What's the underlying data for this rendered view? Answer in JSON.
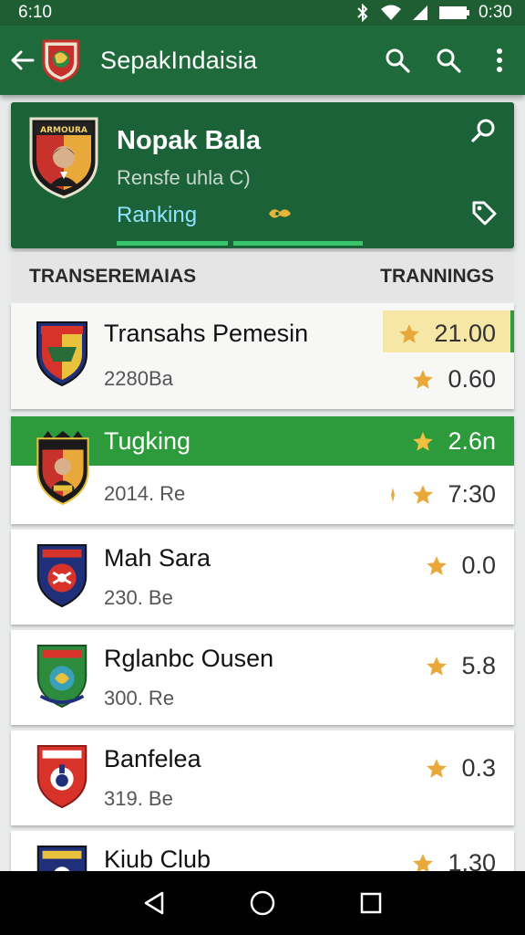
{
  "status": {
    "time": "6:10",
    "clock": "0:30"
  },
  "app": {
    "title": "SepakIndaisia"
  },
  "profile": {
    "name": "Nopak Bala",
    "subtitle": "Rensfe uhla C)",
    "tab": "Ranking",
    "crest_text": "ARMOURA"
  },
  "section": {
    "left": "TRANSEREMAIAS",
    "right": "TRANNINGS"
  },
  "rows": [
    {
      "name": "Transahs Pemesin",
      "sub": "2280Ba",
      "rating_top": "21.00",
      "rating": "0.60"
    },
    {
      "name": "Tugking",
      "sub": "2014. Re",
      "rating_top": "2.6n",
      "rating": "7:30"
    },
    {
      "name": "Mah Sara",
      "sub": "230. Be",
      "rating": "0.0"
    },
    {
      "name": "Rglanbc Ousen",
      "sub": "300. Re",
      "rating": "5.8"
    },
    {
      "name": "Banfelea",
      "sub": "319. Be",
      "rating": "0.3"
    },
    {
      "name": "Kiub Club",
      "sub": "",
      "rating": "1.30"
    }
  ],
  "colors": {
    "primary": "#1f6a3a",
    "card": "#1c6238",
    "highlight": "#2d9a3c",
    "star": "#e8a83a",
    "accent": "#38c46a"
  },
  "icons": {
    "back": "arrow-left-icon",
    "search": "search-icon",
    "search2": "search-icon",
    "more": "more-vert-icon",
    "tag": "tag-icon",
    "star": "star-icon",
    "nav_back": "triangle-back-icon",
    "nav_home": "circle-home-icon",
    "nav_recent": "square-recent-icon"
  }
}
